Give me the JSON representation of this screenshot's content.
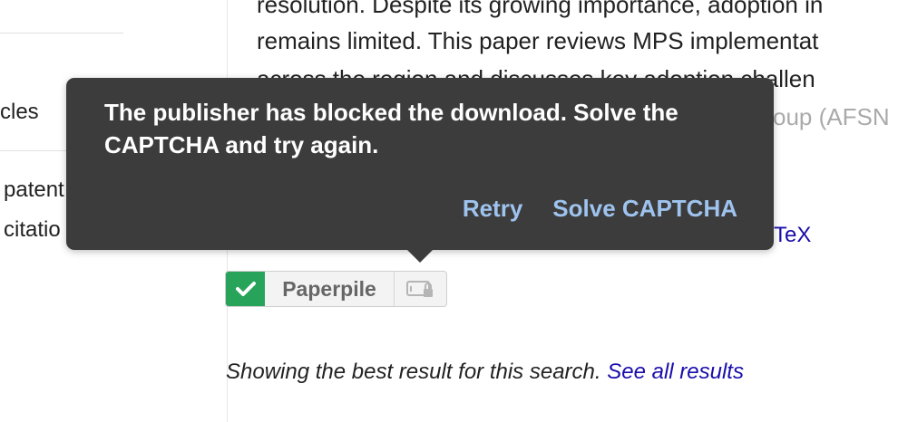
{
  "sidebar": {
    "item_articles": "cles",
    "option_patents": "patent",
    "option_citations": "citatio"
  },
  "abstract": {
    "line1": "resolution. Despite its growing importance, adoption in",
    "line2": "remains limited. This paper reviews MPS implementat",
    "line3": "across the region and discusses key adoption challen",
    "line4": "oup (AFSN"
  },
  "result": {
    "bibtex_fragment": "TeX"
  },
  "paperpile": {
    "label": "Paperpile",
    "status": "check-icon",
    "accent_color": "#27a35a"
  },
  "footer": {
    "showing_text": "Showing the best result for this search.",
    "see_all_link": "See all results"
  },
  "tooltip": {
    "message": "The publisher has blocked the download. Solve the CAPTCHA and try again.",
    "retry_label": "Retry",
    "solve_label": "Solve CAPTCHA",
    "background": "#3c3c3c",
    "link_color": "#9ec3ee"
  }
}
